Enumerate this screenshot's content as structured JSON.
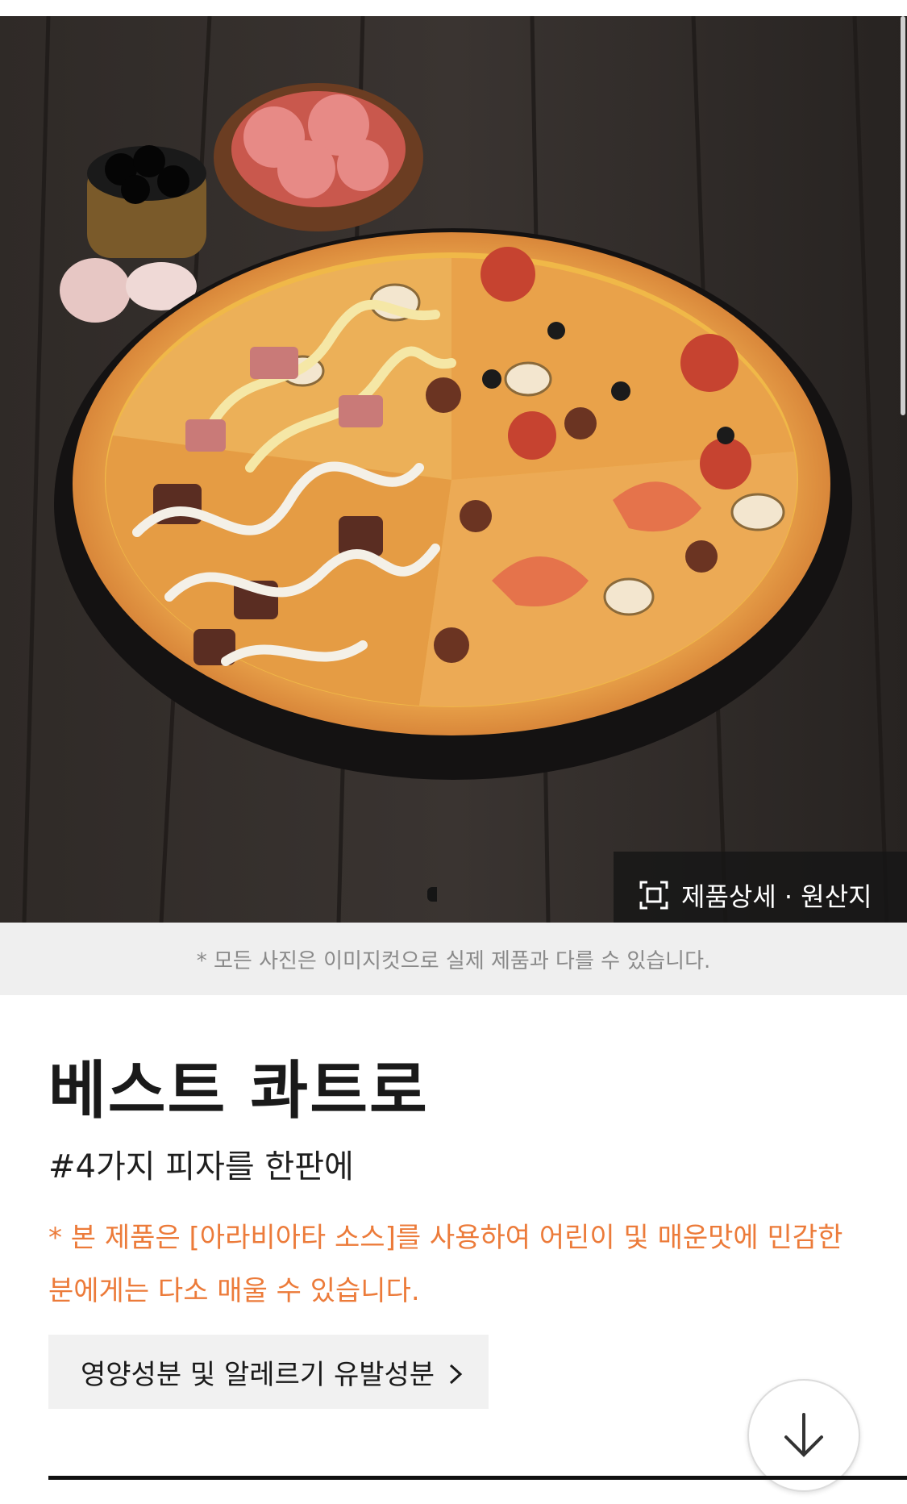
{
  "hero": {
    "detail_button_label": "제품상세 · 원산지",
    "slide_count": 1
  },
  "notice": {
    "text": "* 모든 사진은 이미지컷으로 실제 제품과 다를 수 있습니다."
  },
  "product": {
    "name": "베스트 콰트로",
    "tagline": "#4가지 피자를 한판에",
    "warning": "* 본 제품은 [아라비아타 소스]를 사용하여 어린이 및 매운맛에 민감한 분에게는 다소 매울 수 있습니다."
  },
  "nutrition": {
    "button_label": "영양성분 및 알레르기 유발성분"
  },
  "colors": {
    "warning": "#ec7b3a",
    "notice_bg": "#efefef",
    "button_bg": "#f1f1f1",
    "hero_bg": "#2b2624"
  },
  "icons": {
    "detail": "scan-frame-icon",
    "chevron": "chevron-right-icon",
    "scroll": "arrow-down-icon"
  }
}
